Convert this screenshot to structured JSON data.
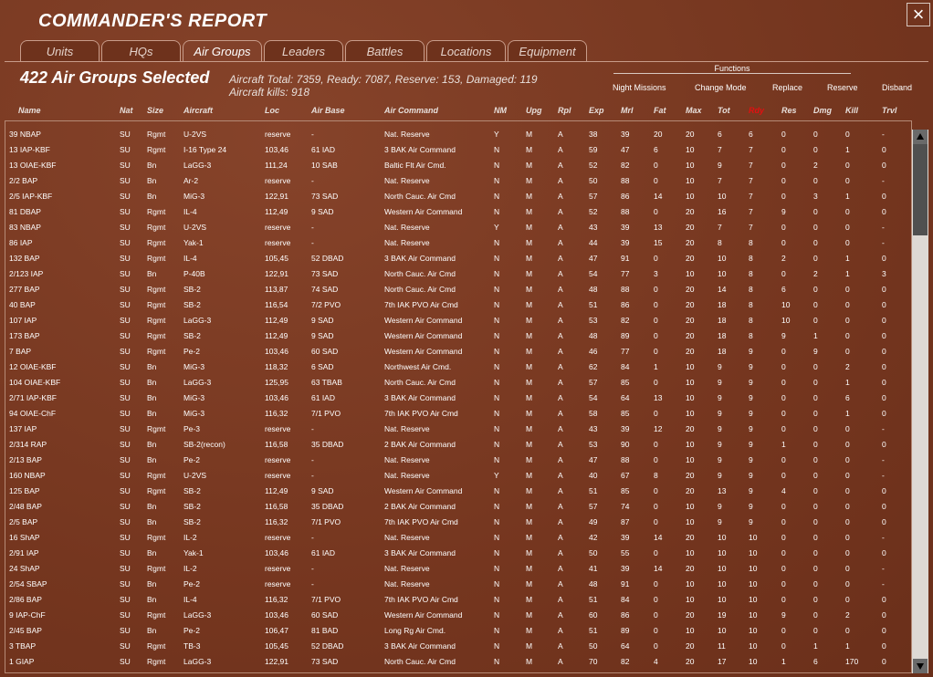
{
  "window": {
    "title": "COMMANDER'S REPORT",
    "close_icon": "×"
  },
  "tabs": [
    "Units",
    "HQs",
    "Air Groups",
    "Leaders",
    "Battles",
    "Locations",
    "Equipment"
  ],
  "active_tab": "Air Groups",
  "summary": {
    "selected": "422 Air Groups Selected",
    "line1": "Aircraft Total: 7359, Ready: 7087, Reserve: 153, Damaged: 119",
    "line2": "Aircraft kills: 918"
  },
  "functions": {
    "header": "Functions",
    "items": [
      "Night Missions",
      "Change Mode",
      "Replace",
      "Reserve",
      "Disband"
    ]
  },
  "columns": [
    "Name",
    "Nat",
    "Size",
    "Aircraft",
    "Loc",
    "Air Base",
    "Air Command",
    "NM",
    "Upg",
    "Rpl",
    "Exp",
    "Mrl",
    "Fat",
    "Max",
    "Tot",
    "Rdy",
    "Res",
    "Dmg",
    "Kill",
    "Trvl"
  ],
  "highlight_color": "#e21010",
  "rows": [
    [
      "39 NBAP",
      "SU",
      "Rgmt",
      "U-2VS",
      "reserve",
      "-",
      "Nat. Reserve",
      "Y",
      "M",
      "A",
      "38",
      "39",
      "20",
      "20",
      "6",
      "6",
      "0",
      "0",
      "0",
      "-"
    ],
    [
      "13 IAP-KBF",
      "SU",
      "Rgmt",
      "I-16 Type 24",
      "103,46",
      "61 IAD",
      "3 BAK Air Command",
      "N",
      "M",
      "A",
      "59",
      "47",
      "6",
      "10",
      "7",
      "7",
      "0",
      "0",
      "1",
      "0"
    ],
    [
      "13 OIAE-KBF",
      "SU",
      "Bn",
      "LaGG-3",
      "111,24",
      "10 SAB",
      "Baltic Flt Air Cmd.",
      "N",
      "M",
      "A",
      "52",
      "82",
      "0",
      "10",
      "9",
      "7",
      "0",
      "2",
      "0",
      "0"
    ],
    [
      "2/2 BAP",
      "SU",
      "Bn",
      "Ar-2",
      "reserve",
      "-",
      "Nat. Reserve",
      "N",
      "M",
      "A",
      "50",
      "88",
      "0",
      "10",
      "7",
      "7",
      "0",
      "0",
      "0",
      "-"
    ],
    [
      "2/5 IAP-KBF",
      "SU",
      "Bn",
      "MiG-3",
      "122,91",
      "73 SAD",
      "North Cauc. Air Cmd",
      "N",
      "M",
      "A",
      "57",
      "86",
      "14",
      "10",
      "10",
      "7",
      "0",
      "3",
      "1",
      "0"
    ],
    [
      "81 DBAP",
      "SU",
      "Rgmt",
      "IL-4",
      "112,49",
      "9 SAD",
      "Western Air Command",
      "N",
      "M",
      "A",
      "52",
      "88",
      "0",
      "20",
      "16",
      "7",
      "9",
      "0",
      "0",
      "0"
    ],
    [
      "83 NBAP",
      "SU",
      "Rgmt",
      "U-2VS",
      "reserve",
      "-",
      "Nat. Reserve",
      "Y",
      "M",
      "A",
      "43",
      "39",
      "13",
      "20",
      "7",
      "7",
      "0",
      "0",
      "0",
      "-"
    ],
    [
      "86 IAP",
      "SU",
      "Rgmt",
      "Yak-1",
      "reserve",
      "-",
      "Nat. Reserve",
      "N",
      "M",
      "A",
      "44",
      "39",
      "15",
      "20",
      "8",
      "8",
      "0",
      "0",
      "0",
      "-"
    ],
    [
      "132 BAP",
      "SU",
      "Rgmt",
      "IL-4",
      "105,45",
      "52 DBAD",
      "3 BAK Air Command",
      "N",
      "M",
      "A",
      "47",
      "91",
      "0",
      "20",
      "10",
      "8",
      "2",
      "0",
      "1",
      "0"
    ],
    [
      "2/123 IAP",
      "SU",
      "Bn",
      "P-40B",
      "122,91",
      "73 SAD",
      "North Cauc. Air Cmd",
      "N",
      "M",
      "A",
      "54",
      "77",
      "3",
      "10",
      "10",
      "8",
      "0",
      "2",
      "1",
      "3"
    ],
    [
      "277 BAP",
      "SU",
      "Rgmt",
      "SB-2",
      "113,87",
      "74 SAD",
      "North Cauc. Air Cmd",
      "N",
      "M",
      "A",
      "48",
      "88",
      "0",
      "20",
      "14",
      "8",
      "6",
      "0",
      "0",
      "0"
    ],
    [
      "40 BAP",
      "SU",
      "Rgmt",
      "SB-2",
      "116,54",
      "7/2 PVO",
      "7th IAK PVO Air Cmd",
      "N",
      "M",
      "A",
      "51",
      "86",
      "0",
      "20",
      "18",
      "8",
      "10",
      "0",
      "0",
      "0"
    ],
    [
      "107 IAP",
      "SU",
      "Rgmt",
      "LaGG-3",
      "112,49",
      "9 SAD",
      "Western Air Command",
      "N",
      "M",
      "A",
      "53",
      "82",
      "0",
      "20",
      "18",
      "8",
      "10",
      "0",
      "0",
      "0"
    ],
    [
      "173 BAP",
      "SU",
      "Rgmt",
      "SB-2",
      "112,49",
      "9 SAD",
      "Western Air Command",
      "N",
      "M",
      "A",
      "48",
      "89",
      "0",
      "20",
      "18",
      "8",
      "9",
      "1",
      "0",
      "0"
    ],
    [
      "7 BAP",
      "SU",
      "Rgmt",
      "Pe-2",
      "103,46",
      "60 SAD",
      "Western Air Command",
      "N",
      "M",
      "A",
      "46",
      "77",
      "0",
      "20",
      "18",
      "9",
      "0",
      "9",
      "0",
      "0"
    ],
    [
      "12 OIAE-KBF",
      "SU",
      "Bn",
      "MiG-3",
      "118,32",
      "6 SAD",
      "Northwest Air Cmd.",
      "N",
      "M",
      "A",
      "62",
      "84",
      "1",
      "10",
      "9",
      "9",
      "0",
      "0",
      "2",
      "0"
    ],
    [
      "104 OIAE-KBF",
      "SU",
      "Bn",
      "LaGG-3",
      "125,95",
      "63 TBAB",
      "North Cauc. Air Cmd",
      "N",
      "M",
      "A",
      "57",
      "85",
      "0",
      "10",
      "9",
      "9",
      "0",
      "0",
      "1",
      "0"
    ],
    [
      "2/71 IAP-KBF",
      "SU",
      "Bn",
      "MiG-3",
      "103,46",
      "61 IAD",
      "3 BAK Air Command",
      "N",
      "M",
      "A",
      "54",
      "64",
      "13",
      "10",
      "9",
      "9",
      "0",
      "0",
      "6",
      "0"
    ],
    [
      "94 OIAE-ChF",
      "SU",
      "Bn",
      "MiG-3",
      "116,32",
      "7/1 PVO",
      "7th IAK PVO Air Cmd",
      "N",
      "M",
      "A",
      "58",
      "85",
      "0",
      "10",
      "9",
      "9",
      "0",
      "0",
      "1",
      "0"
    ],
    [
      "137 IAP",
      "SU",
      "Rgmt",
      "Pe-3",
      "reserve",
      "-",
      "Nat. Reserve",
      "N",
      "M",
      "A",
      "43",
      "39",
      "12",
      "20",
      "9",
      "9",
      "0",
      "0",
      "0",
      "-"
    ],
    [
      "2/314 RAP",
      "SU",
      "Bn",
      "SB-2(recon)",
      "116,58",
      "35 DBAD",
      "2 BAK Air Command",
      "N",
      "M",
      "A",
      "53",
      "90",
      "0",
      "10",
      "9",
      "9",
      "1",
      "0",
      "0",
      "0"
    ],
    [
      "2/13 BAP",
      "SU",
      "Bn",
      "Pe-2",
      "reserve",
      "-",
      "Nat. Reserve",
      "N",
      "M",
      "A",
      "47",
      "88",
      "0",
      "10",
      "9",
      "9",
      "0",
      "0",
      "0",
      "-"
    ],
    [
      "160 NBAP",
      "SU",
      "Rgmt",
      "U-2VS",
      "reserve",
      "-",
      "Nat. Reserve",
      "Y",
      "M",
      "A",
      "40",
      "67",
      "8",
      "20",
      "9",
      "9",
      "0",
      "0",
      "0",
      "-"
    ],
    [
      "125 BAP",
      "SU",
      "Rgmt",
      "SB-2",
      "112,49",
      "9 SAD",
      "Western Air Command",
      "N",
      "M",
      "A",
      "51",
      "85",
      "0",
      "20",
      "13",
      "9",
      "4",
      "0",
      "0",
      "0"
    ],
    [
      "2/48 BAP",
      "SU",
      "Bn",
      "SB-2",
      "116,58",
      "35 DBAD",
      "2 BAK Air Command",
      "N",
      "M",
      "A",
      "57",
      "74",
      "0",
      "10",
      "9",
      "9",
      "0",
      "0",
      "0",
      "0"
    ],
    [
      "2/5 BAP",
      "SU",
      "Bn",
      "SB-2",
      "116,32",
      "7/1 PVO",
      "7th IAK PVO Air Cmd",
      "N",
      "M",
      "A",
      "49",
      "87",
      "0",
      "10",
      "9",
      "9",
      "0",
      "0",
      "0",
      "0"
    ],
    [
      "16 ShAP",
      "SU",
      "Rgmt",
      "IL-2",
      "reserve",
      "-",
      "Nat. Reserve",
      "N",
      "M",
      "A",
      "42",
      "39",
      "14",
      "20",
      "10",
      "10",
      "0",
      "0",
      "0",
      "-"
    ],
    [
      "2/91 IAP",
      "SU",
      "Bn",
      "Yak-1",
      "103,46",
      "61 IAD",
      "3 BAK Air Command",
      "N",
      "M",
      "A",
      "50",
      "55",
      "0",
      "10",
      "10",
      "10",
      "0",
      "0",
      "0",
      "0"
    ],
    [
      "24 ShAP",
      "SU",
      "Rgmt",
      "IL-2",
      "reserve",
      "-",
      "Nat. Reserve",
      "N",
      "M",
      "A",
      "41",
      "39",
      "14",
      "20",
      "10",
      "10",
      "0",
      "0",
      "0",
      "-"
    ],
    [
      "2/54 SBAP",
      "SU",
      "Bn",
      "Pe-2",
      "reserve",
      "-",
      "Nat. Reserve",
      "N",
      "M",
      "A",
      "48",
      "91",
      "0",
      "10",
      "10",
      "10",
      "0",
      "0",
      "0",
      "-"
    ],
    [
      "2/86 BAP",
      "SU",
      "Bn",
      "IL-4",
      "116,32",
      "7/1 PVO",
      "7th IAK PVO Air Cmd",
      "N",
      "M",
      "A",
      "51",
      "84",
      "0",
      "10",
      "10",
      "10",
      "0",
      "0",
      "0",
      "0"
    ],
    [
      "9 IAP-ChF",
      "SU",
      "Rgmt",
      "LaGG-3",
      "103,46",
      "60 SAD",
      "Western Air Command",
      "N",
      "M",
      "A",
      "60",
      "86",
      "0",
      "20",
      "19",
      "10",
      "9",
      "0",
      "2",
      "0"
    ],
    [
      "2/45 BAP",
      "SU",
      "Bn",
      "Pe-2",
      "106,47",
      "81 BAD",
      "Long Rg Air Cmd.",
      "N",
      "M",
      "A",
      "51",
      "89",
      "0",
      "10",
      "10",
      "10",
      "0",
      "0",
      "0",
      "0"
    ],
    [
      "3 TBAP",
      "SU",
      "Rgmt",
      "TB-3",
      "105,45",
      "52 DBAD",
      "3 BAK Air Command",
      "N",
      "M",
      "A",
      "50",
      "64",
      "0",
      "20",
      "11",
      "10",
      "0",
      "1",
      "1",
      "0"
    ],
    [
      "1 GIAP",
      "SU",
      "Rgmt",
      "LaGG-3",
      "122,91",
      "73 SAD",
      "North Cauc. Air Cmd",
      "N",
      "M",
      "A",
      "70",
      "82",
      "4",
      "20",
      "17",
      "10",
      "1",
      "6",
      "170",
      "0"
    ]
  ]
}
